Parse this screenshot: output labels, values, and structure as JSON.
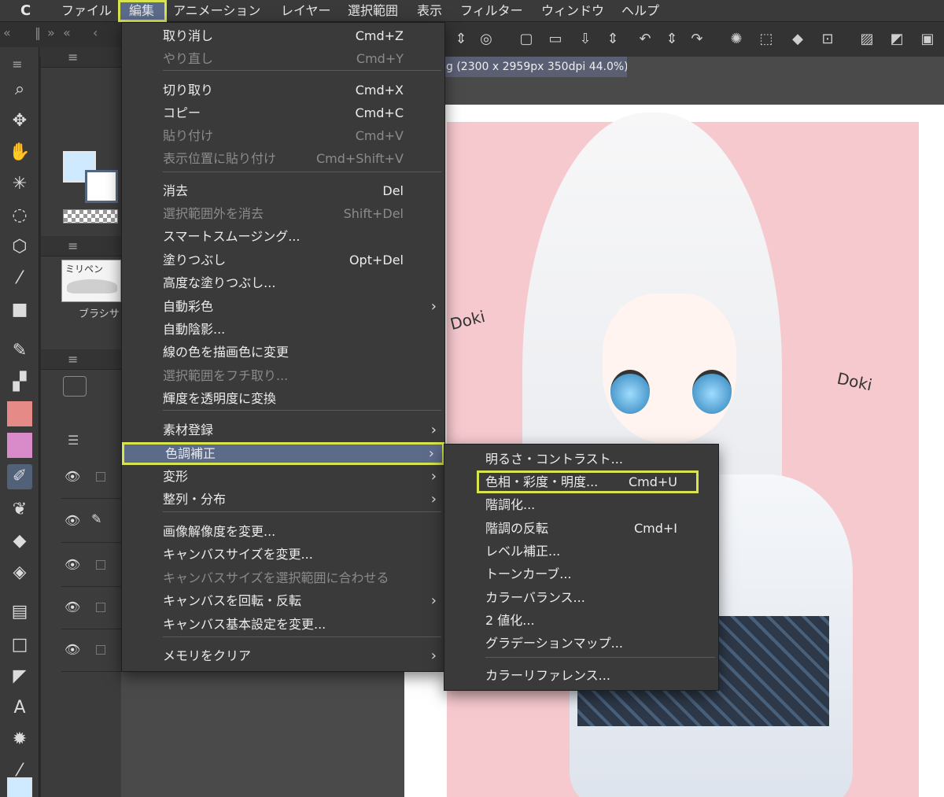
{
  "menubar": {
    "app_logo": "C",
    "items": [
      "ファイル",
      "編集",
      "アニメーション",
      "レイヤー",
      "選択範囲",
      "表示",
      "フィルター",
      "ウィンドウ",
      "ヘルプ"
    ]
  },
  "document": {
    "tab_title": "g (2300 x 2959px 350dpi 44.0%)"
  },
  "palettes": {
    "brush_card_name": "ミリペン",
    "brush_label": "ブラシサ"
  },
  "edit_menu": {
    "items": [
      {
        "label": "取り消し",
        "shortcut": "Cmd+Z",
        "disabled": false
      },
      {
        "label": "やり直し",
        "shortcut": "Cmd+Y",
        "disabled": true
      },
      {
        "label": "切り取り",
        "shortcut": "Cmd+X",
        "disabled": false
      },
      {
        "label": "コピー",
        "shortcut": "Cmd+C",
        "disabled": false
      },
      {
        "label": "貼り付け",
        "shortcut": "Cmd+V",
        "disabled": true
      },
      {
        "label": "表示位置に貼り付け",
        "shortcut": "Cmd+Shift+V",
        "disabled": true
      },
      {
        "label": "消去",
        "shortcut": "Del",
        "disabled": false
      },
      {
        "label": "選択範囲外を消去",
        "shortcut": "Shift+Del",
        "disabled": true
      },
      {
        "label": "スマートスムージング...",
        "shortcut": "",
        "disabled": false
      },
      {
        "label": "塗りつぶし",
        "shortcut": "Opt+Del",
        "disabled": false
      },
      {
        "label": "高度な塗りつぶし...",
        "shortcut": "",
        "disabled": false
      },
      {
        "label": "自動彩色",
        "shortcut": "",
        "disabled": false,
        "submenu": true
      },
      {
        "label": "自動陰影...",
        "shortcut": "",
        "disabled": false
      },
      {
        "label": "線の色を描画色に変更",
        "shortcut": "",
        "disabled": false
      },
      {
        "label": "選択範囲をフチ取り...",
        "shortcut": "",
        "disabled": true
      },
      {
        "label": "輝度を透明度に変換",
        "shortcut": "",
        "disabled": false
      },
      {
        "label": "素材登録",
        "shortcut": "",
        "disabled": false,
        "submenu": true
      },
      {
        "label": "色調補正",
        "shortcut": "",
        "disabled": false,
        "submenu": true,
        "highlighted": true
      },
      {
        "label": "変形",
        "shortcut": "",
        "disabled": false,
        "submenu": true
      },
      {
        "label": "整列・分布",
        "shortcut": "",
        "disabled": false,
        "submenu": true
      },
      {
        "label": "画像解像度を変更...",
        "shortcut": "",
        "disabled": false
      },
      {
        "label": "キャンバスサイズを変更...",
        "shortcut": "",
        "disabled": false
      },
      {
        "label": "キャンバスサイズを選択範囲に合わせる",
        "shortcut": "",
        "disabled": true
      },
      {
        "label": "キャンバスを回転・反転",
        "shortcut": "",
        "disabled": false,
        "submenu": true
      },
      {
        "label": "キャンバス基本設定を変更...",
        "shortcut": "",
        "disabled": false
      },
      {
        "label": "メモリをクリア",
        "shortcut": "",
        "disabled": false,
        "submenu": true
      }
    ]
  },
  "color_submenu": {
    "items": [
      {
        "label": "明るさ・コントラスト...",
        "shortcut": ""
      },
      {
        "label": "色相・彩度・明度...",
        "shortcut": "Cmd+U",
        "boxed": true
      },
      {
        "label": "階調化...",
        "shortcut": ""
      },
      {
        "label": "階調の反転",
        "shortcut": "Cmd+I"
      },
      {
        "label": "レベル補正...",
        "shortcut": ""
      },
      {
        "label": "トーンカーブ...",
        "shortcut": ""
      },
      {
        "label": "カラーバランス...",
        "shortcut": ""
      },
      {
        "label": "2 値化...",
        "shortcut": ""
      },
      {
        "label": "グラデーションマップ...",
        "shortcut": ""
      },
      {
        "label": "カラーリファレンス...",
        "shortcut": ""
      }
    ]
  },
  "artwork": {
    "scribble_left": "Doki",
    "scribble_right": "Doki"
  },
  "colors": {
    "highlight_outline": "#d7e44e",
    "menu_selection": "#5c6b8a",
    "main_color": "#cfe9ff",
    "canvas_pink": "#f6c9cf"
  }
}
